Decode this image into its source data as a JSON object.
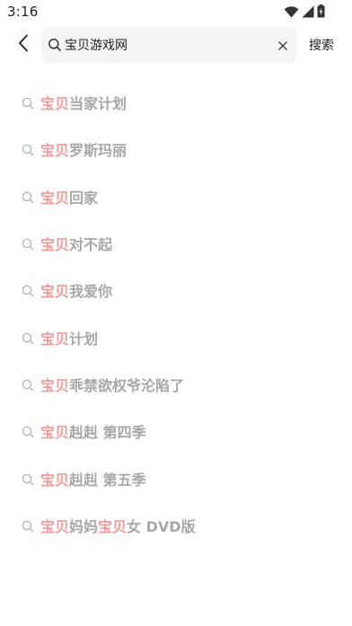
{
  "status_bar": {
    "time": "3:16"
  },
  "header": {
    "query_value": "宝贝游戏网",
    "search_label": "搜索"
  },
  "suggestions": [
    {
      "highlight": "宝贝",
      "rest": "当家计划"
    },
    {
      "highlight": "宝贝",
      "rest": "罗斯玛丽"
    },
    {
      "highlight": "宝贝",
      "rest": "回家"
    },
    {
      "highlight": "宝贝",
      "rest": "对不起"
    },
    {
      "highlight": "宝贝",
      "rest": "我爱你"
    },
    {
      "highlight": "宝贝",
      "rest": "计划"
    },
    {
      "highlight": "宝贝",
      "rest": "乖禁欲权爷沦陷了"
    },
    {
      "highlight": "宝贝",
      "rest": "赳赳 第四季"
    },
    {
      "highlight": "宝贝",
      "rest": "赳赳 第五季"
    },
    {
      "highlight": "宝贝",
      "rest": "妈妈",
      "highlight2": "宝贝",
      "rest2": "女 DVD版"
    }
  ],
  "icons": {
    "back": "back-arrow-icon",
    "search": "search-icon",
    "clear": "close-icon",
    "wifi": "wifi-icon",
    "signal": "signal-icon",
    "battery": "battery-icon"
  },
  "colors": {
    "highlight": "#f39a9a",
    "suggestion_text": "#a7a7a7",
    "search_box_bg": "#f4f4f4"
  }
}
